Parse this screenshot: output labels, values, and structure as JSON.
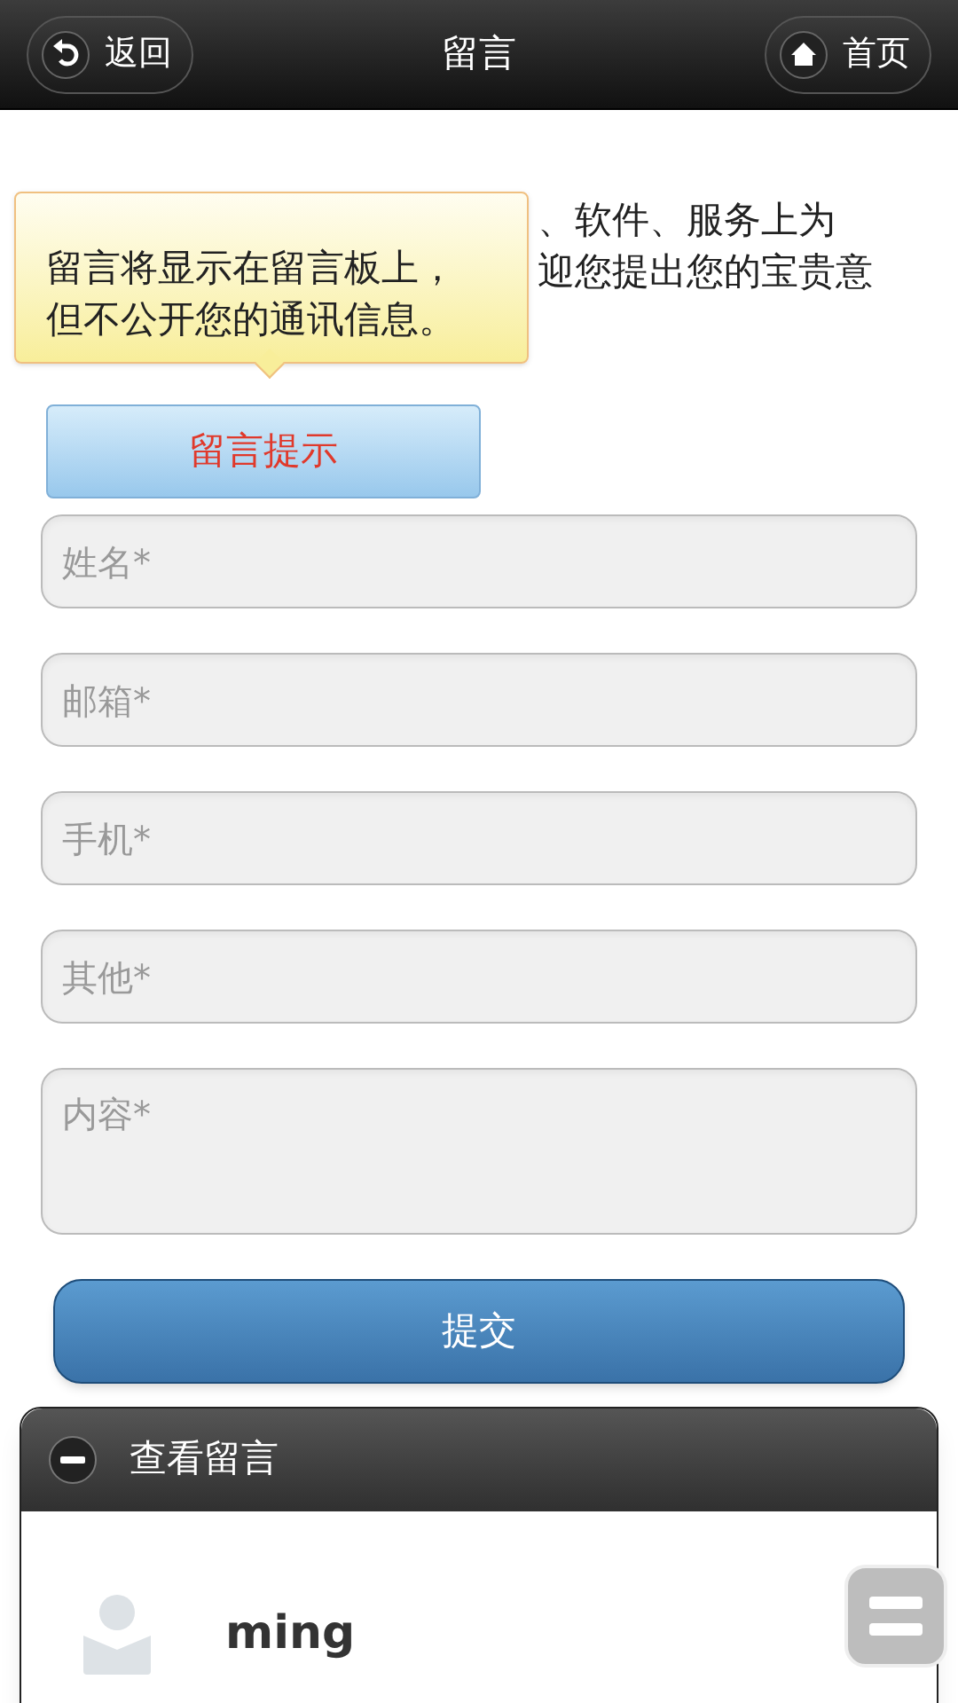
{
  "header": {
    "back": "返回",
    "title": "留言",
    "home": "首页"
  },
  "intro_lines": [
    "、软件、服务上为",
    "迎您提出您的宝贵意"
  ],
  "tooltip": [
    "留言将显示在留言板上，",
    "但不公开您的通讯信息。"
  ],
  "hint_button": "留言提示",
  "fields": [
    {
      "placeholder": "姓名*",
      "kind": "input"
    },
    {
      "placeholder": "邮箱*",
      "kind": "input"
    },
    {
      "placeholder": "手机*",
      "kind": "input"
    },
    {
      "placeholder": "其他*",
      "kind": "input"
    },
    {
      "placeholder": "内容*",
      "kind": "textarea"
    }
  ],
  "submit": "提交",
  "messages_panel": {
    "title": "查看留言",
    "expanded": true,
    "entries": [
      {
        "name": "ming"
      }
    ]
  }
}
